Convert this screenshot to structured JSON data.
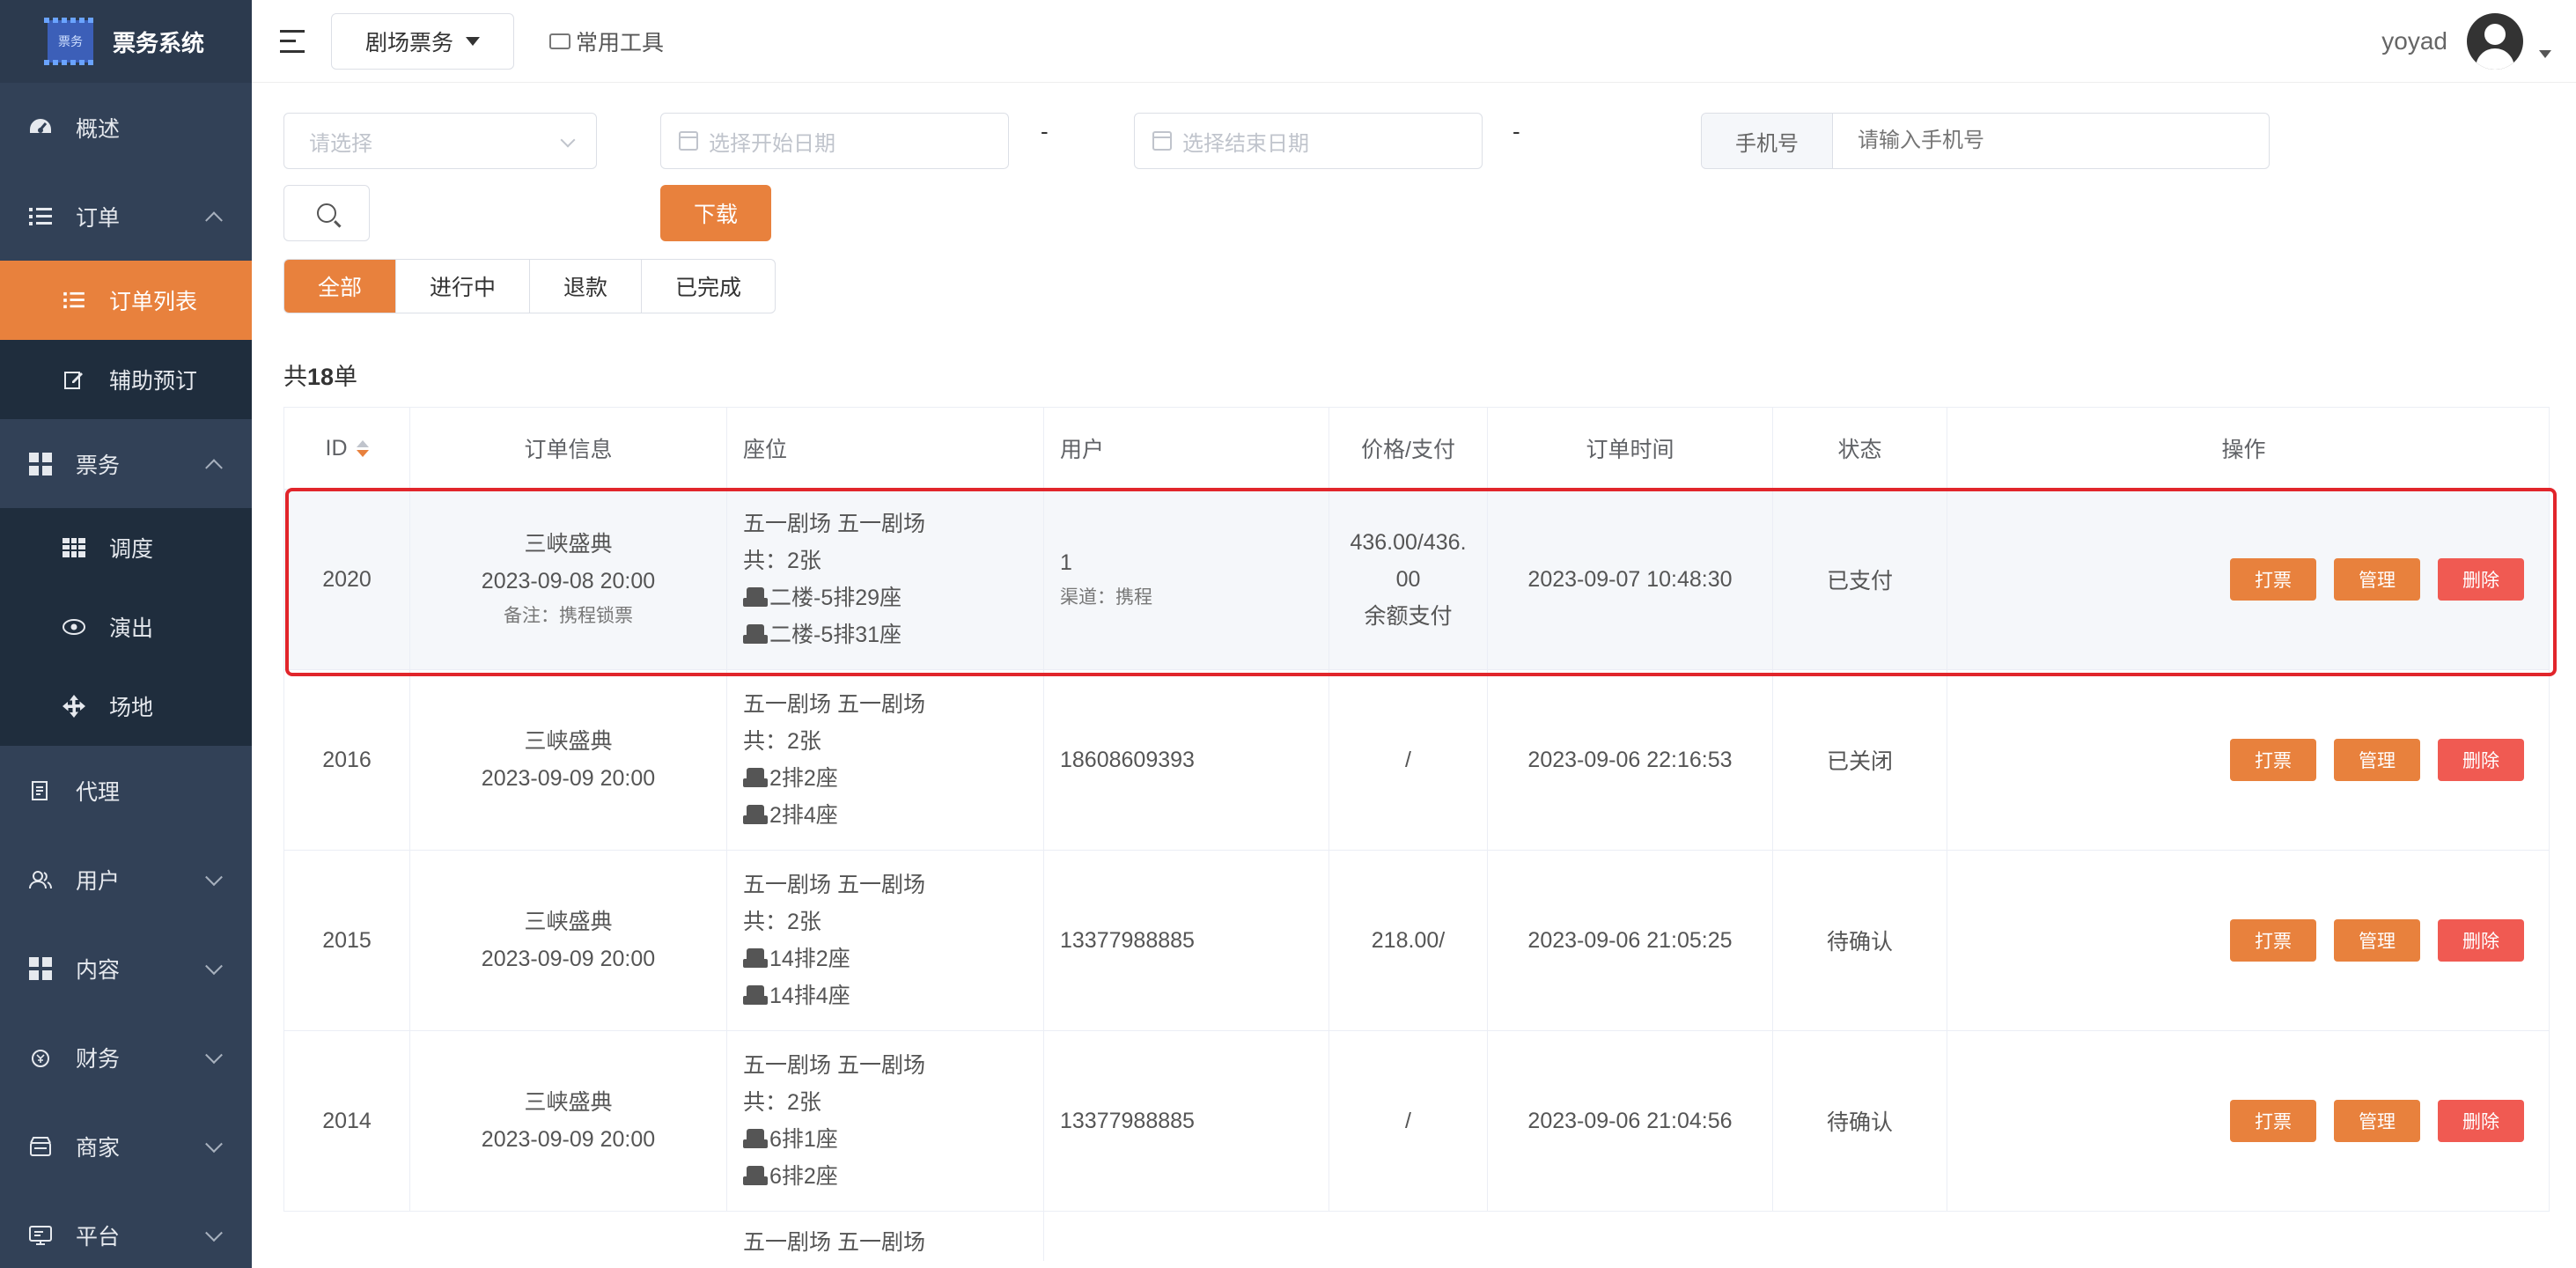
{
  "app": {
    "title": "票务系统",
    "logo_text": "票务"
  },
  "sidebar": {
    "items": [
      {
        "label": "概述",
        "icon": "dashboard-icon"
      },
      {
        "label": "订单",
        "icon": "list-icon",
        "expanded": true,
        "children": [
          {
            "label": "订单列表",
            "icon": "list-icon",
            "active": true
          },
          {
            "label": "辅助预订",
            "icon": "edit-icon"
          }
        ]
      },
      {
        "label": "票务",
        "icon": "grid-icon",
        "expanded": true,
        "children": [
          {
            "label": "调度",
            "icon": "table-icon"
          },
          {
            "label": "演出",
            "icon": "eye-icon"
          },
          {
            "label": "场地",
            "icon": "move-icon"
          }
        ]
      },
      {
        "label": "代理",
        "icon": "agent-icon"
      },
      {
        "label": "用户",
        "icon": "users-icon"
      },
      {
        "label": "内容",
        "icon": "grid-icon"
      },
      {
        "label": "财务",
        "icon": "finance-icon"
      },
      {
        "label": "商家",
        "icon": "shop-icon"
      },
      {
        "label": "平台",
        "icon": "platform-icon"
      }
    ]
  },
  "topbar": {
    "dropdown_label": "剧场票务",
    "tools_label": "常用工具",
    "username": "yoyad"
  },
  "filters": {
    "select_placeholder": "请选择",
    "start_date_placeholder": "选择开始日期",
    "end_date_placeholder": "选择结束日期",
    "dash": "-",
    "phone_label": "手机号",
    "phone_placeholder": "请输入手机号",
    "download_label": "下载"
  },
  "tabs": [
    {
      "label": "全部",
      "active": true
    },
    {
      "label": "进行中"
    },
    {
      "label": "退款"
    },
    {
      "label": "已完成"
    }
  ],
  "summary": {
    "prefix": "共",
    "count": "18",
    "suffix": "单"
  },
  "table": {
    "headers": {
      "id": "ID",
      "info": "订单信息",
      "seat": "座位",
      "user": "用户",
      "price": "价格/支付",
      "time": "订单时间",
      "status": "状态",
      "ops": "操作"
    },
    "actions": {
      "print": "打票",
      "manage": "管理",
      "delete": "删除"
    },
    "rows": [
      {
        "id": "2020",
        "show": "三峡盛典",
        "datetime": "2023-09-08 20:00",
        "note": "备注：携程锁票",
        "venue": "五一剧场 五一剧场",
        "count": "共：2张",
        "seats": [
          "二楼-5排29座",
          "二楼-5排31座"
        ],
        "user": "1",
        "channel": "渠道：携程",
        "price": "436.00/436.",
        "price2": "00",
        "payment": "余额支付",
        "time": "2023-09-07 10:48:30",
        "status": "已支付"
      },
      {
        "id": "2016",
        "show": "三峡盛典",
        "datetime": "2023-09-09 20:00",
        "venue": "五一剧场 五一剧场",
        "count": "共：2张",
        "seats": [
          "2排2座",
          "2排4座"
        ],
        "user": "18608609393",
        "price": "/",
        "time": "2023-09-06 22:16:53",
        "status": "已关闭"
      },
      {
        "id": "2015",
        "show": "三峡盛典",
        "datetime": "2023-09-09 20:00",
        "venue": "五一剧场 五一剧场",
        "count": "共：2张",
        "seats": [
          "14排2座",
          "14排4座"
        ],
        "user": "13377988885",
        "price": "218.00/",
        "time": "2023-09-06 21:05:25",
        "status": "待确认"
      },
      {
        "id": "2014",
        "show": "三峡盛典",
        "datetime": "2023-09-09 20:00",
        "venue": "五一剧场 五一剧场",
        "count": "共：2张",
        "seats": [
          "6排1座",
          "6排2座"
        ],
        "user": "13377988885",
        "price": "/",
        "time": "2023-09-06 21:04:56",
        "status": "待确认"
      },
      {
        "venue": "五一剧场 五一剧场"
      }
    ]
  },
  "colors": {
    "sidebar_bg": "#324157",
    "submenu_bg": "#1f2d3d",
    "accent": "#e8813d",
    "danger": "#f05a52",
    "highlight": "#e1252b"
  }
}
